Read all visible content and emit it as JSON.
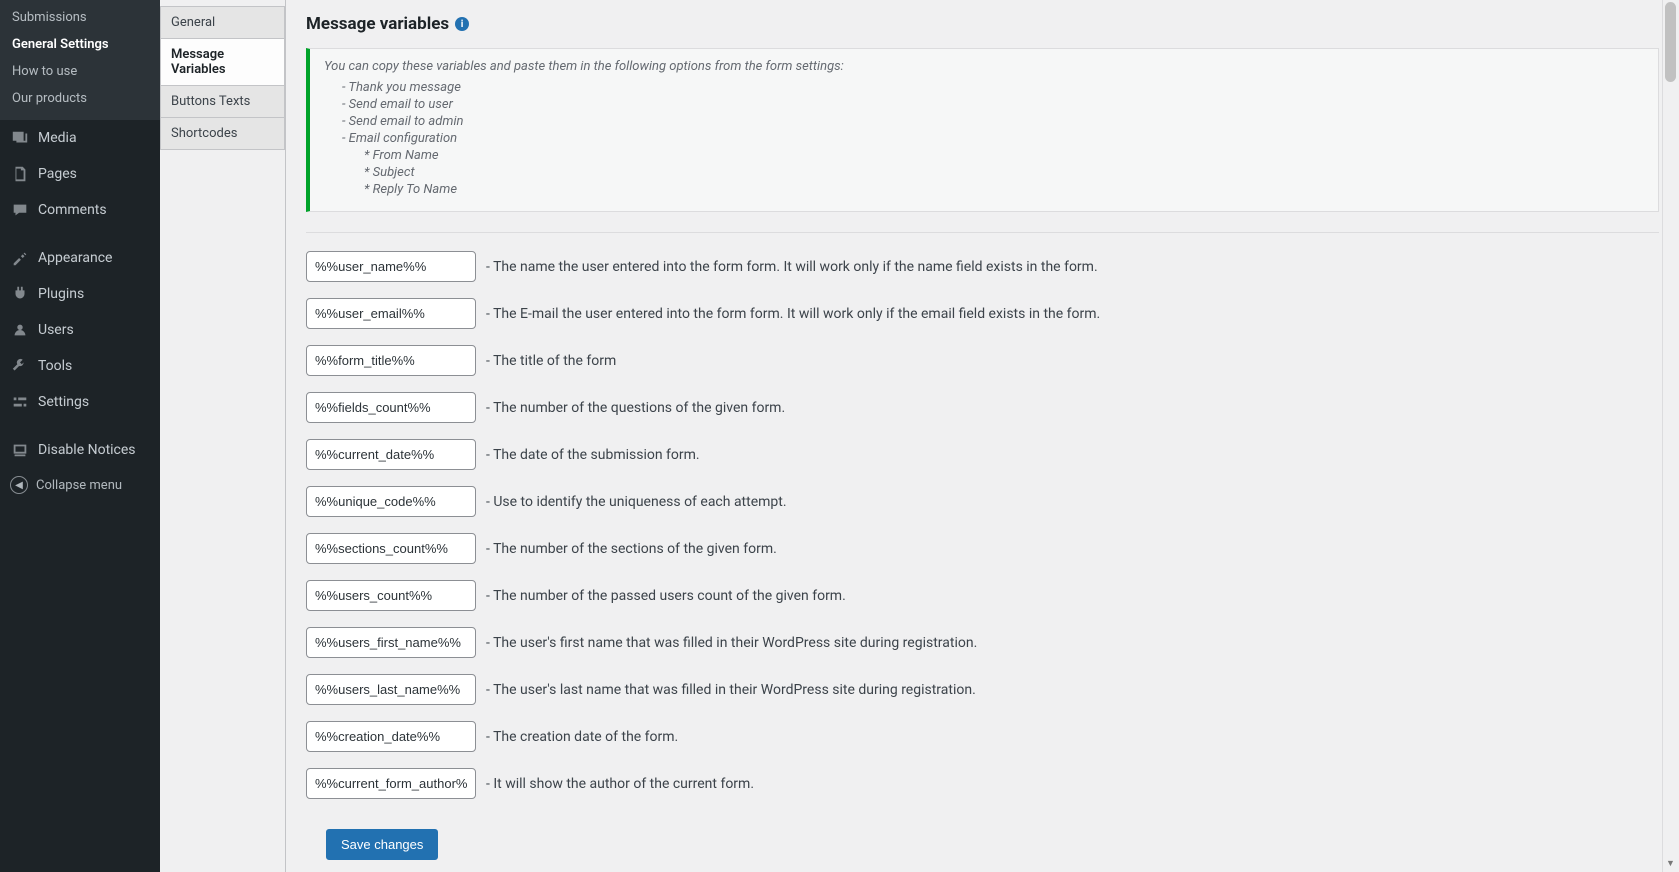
{
  "sidebar": {
    "submenu": [
      {
        "label": "Submissions",
        "current": false
      },
      {
        "label": "General Settings",
        "current": true
      },
      {
        "label": "How to use",
        "current": false
      },
      {
        "label": "Our products",
        "current": false
      }
    ],
    "items": [
      {
        "label": "Media",
        "icon": "media"
      },
      {
        "label": "Pages",
        "icon": "pages"
      },
      {
        "label": "Comments",
        "icon": "comments"
      },
      {
        "label": "Appearance",
        "icon": "appearance"
      },
      {
        "label": "Plugins",
        "icon": "plugins"
      },
      {
        "label": "Users",
        "icon": "users"
      },
      {
        "label": "Tools",
        "icon": "tools"
      },
      {
        "label": "Settings",
        "icon": "settings"
      },
      {
        "label": "Disable Notices",
        "icon": "notices"
      }
    ],
    "collapse": "Collapse menu"
  },
  "tabs": [
    {
      "label": "General",
      "active": false
    },
    {
      "label": "Message Variables",
      "active": true
    },
    {
      "label": "Buttons Texts",
      "active": false
    },
    {
      "label": "Shortcodes",
      "active": false
    }
  ],
  "heading": "Message variables",
  "notice": {
    "lead": "You can copy these variables and paste them in the following options from the form settings:",
    "l1": [
      "- Thank you message",
      "- Send email to user",
      "- Send email to admin",
      "- Email configuration"
    ],
    "l2": [
      "* From Name",
      "* Subject",
      "* Reply To Name"
    ]
  },
  "variables": [
    {
      "token": "%%user_name%%",
      "desc": "- The name the user entered into the form form. It will work only if the name field exists in the form."
    },
    {
      "token": "%%user_email%%",
      "desc": "- The E-mail the user entered into the form form. It will work only if the email field exists in the form."
    },
    {
      "token": "%%form_title%%",
      "desc": "- The title of the form"
    },
    {
      "token": "%%fields_count%%",
      "desc": "- The number of the questions of the given form."
    },
    {
      "token": "%%current_date%%",
      "desc": "- The date of the submission form."
    },
    {
      "token": "%%unique_code%%",
      "desc": "- Use to identify the uniqueness of each attempt."
    },
    {
      "token": "%%sections_count%%",
      "desc": "- The number of the sections of the given form."
    },
    {
      "token": "%%users_count%%",
      "desc": "- The number of the passed users count of the given form."
    },
    {
      "token": "%%users_first_name%%",
      "desc": "- The user's first name that was filled in their WordPress site during registration."
    },
    {
      "token": "%%users_last_name%%",
      "desc": "- The user's last name that was filled in their WordPress site during registration."
    },
    {
      "token": "%%creation_date%%",
      "desc": "- The creation date of the form."
    },
    {
      "token": "%%current_form_author%%",
      "desc": "- It will show the author of the current form."
    }
  ],
  "save_label": "Save changes"
}
